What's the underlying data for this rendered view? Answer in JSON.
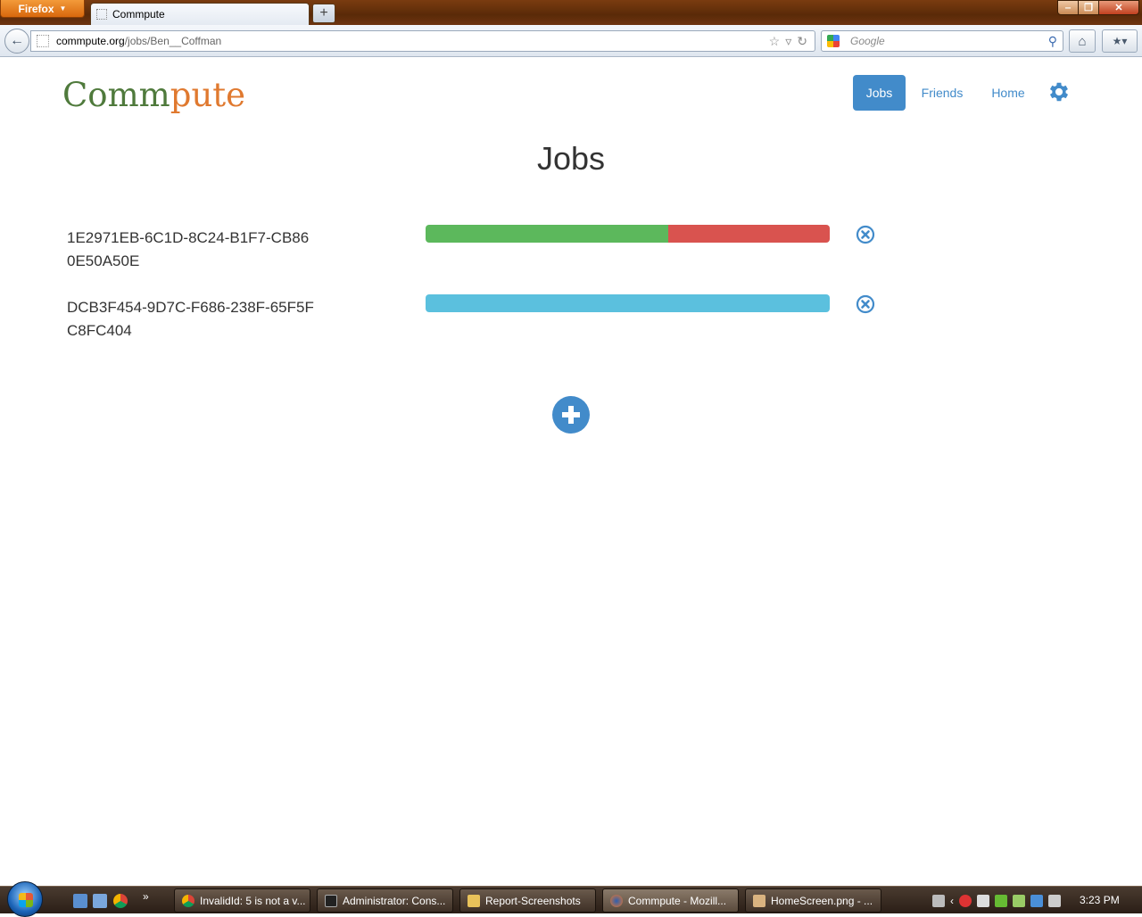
{
  "browser": {
    "menu_button": "Firefox",
    "tab_title": "Commpute",
    "new_tab": "+",
    "url_host": "commpute.org",
    "url_path": "/jobs/Ben__Coffman",
    "search_placeholder": "Google"
  },
  "site": {
    "logo_part1": "Comm",
    "logo_part2": "pute",
    "nav": {
      "jobs": "Jobs",
      "friends": "Friends",
      "home": "Home"
    },
    "page_title": "Jobs"
  },
  "jobs": [
    {
      "id": "1E2971EB-6C1D-8C24-B1F7-CB860E50A50E",
      "progress": {
        "success_fraction": 0.6,
        "danger_fraction": 0.4,
        "info_fraction": 0
      }
    },
    {
      "id": "DCB3F454-9D7C-F686-238F-65F5FC8FC404",
      "progress": {
        "success_fraction": 0,
        "danger_fraction": 0,
        "info_fraction": 1.0
      }
    }
  ],
  "colors": {
    "primary": "#428bca",
    "success": "#5cb85c",
    "danger": "#d9534f",
    "info": "#5bc0de",
    "logo_green": "#4f7a3c",
    "logo_orange": "#e0792f"
  },
  "taskbar": {
    "tasks": [
      {
        "label": "InvalidId: 5 is not a v...",
        "icon": "chrome-icon"
      },
      {
        "label": "Administrator: Cons...",
        "icon": "console-icon"
      },
      {
        "label": "Report-Screenshots",
        "icon": "folder-icon"
      },
      {
        "label": "Commpute - Mozill...",
        "icon": "firefox-icon"
      },
      {
        "label": "HomeScreen.png - ...",
        "icon": "paint-icon"
      }
    ],
    "clock": "3:23 PM"
  }
}
